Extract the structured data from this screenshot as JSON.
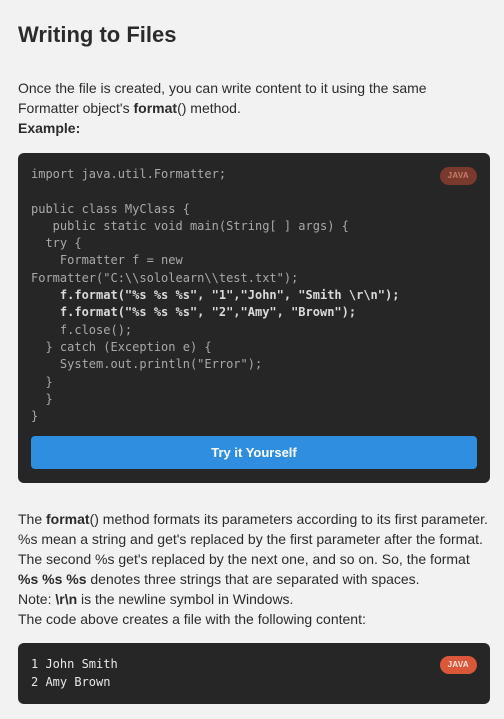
{
  "lesson": {
    "title": "Writing to Files",
    "intro_text": "Once the file is created, you can write content to it using the same Formatter object's ",
    "intro_method": "format",
    "intro_after": "() method.",
    "example_label": "Example:"
  },
  "code_block": {
    "language_badge": "JAVA",
    "lines": [
      "import java.util.Formatter;",
      "",
      "public class MyClass {",
      "   public static void main(String[ ] args) {",
      "  try {",
      "    Formatter f = new",
      "Formatter(\"C:\\\\sololearn\\\\test.txt\");",
      "    f.format(\"%s %s %s\", \"1\",\"John\", \"Smith \\r\\n\");",
      "    f.format(\"%s %s %s\", \"2\",\"Amy\", \"Brown\");",
      "    f.close();",
      "  } catch (Exception e) {",
      "    System.out.println(\"Error\");",
      "  }",
      "  }",
      "}"
    ],
    "bold_lines": [
      7,
      8
    ],
    "try_button_label": "Try it Yourself"
  },
  "explanation": {
    "p1_start": "The ",
    "p1_method": "format",
    "p1_rest": "() method formats its parameters according to its first parameter. %s mean a string and get's replaced by the first parameter after the format. The second %s get's replaced by the next one, and so on. So, the format ",
    "p1_fmt": "%s %s %s",
    "p1_end": " denotes three strings that are separated with spaces.",
    "note_start": "Note: ",
    "note_code": "\\r\\n",
    "note_end": " is the newline symbol in Windows.",
    "p3": "The code above creates a file with the following content:"
  },
  "output_block": {
    "language_badge": "JAVA",
    "lines": [
      "1 John Smith",
      "2 Amy Brown"
    ]
  },
  "colors": {
    "page_bg": "#f2f2f2",
    "code_bg": "#262626",
    "button_blue": "#2f8ee0",
    "badge_orange": "#d9583a"
  }
}
